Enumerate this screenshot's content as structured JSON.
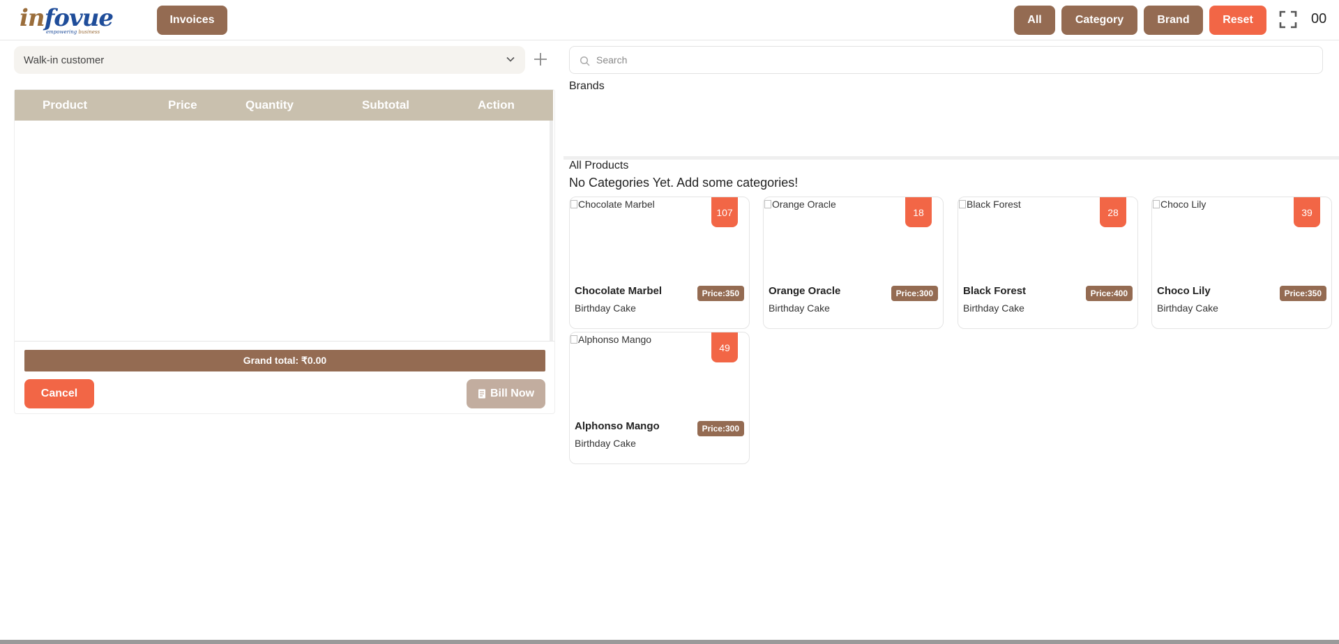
{
  "header": {
    "logo": {
      "word_part1": "in",
      "word_part2": "fovue",
      "tagline_part1": "empowering",
      "tagline_part2": "business"
    },
    "invoices_label": "Invoices",
    "filters": {
      "all": "All",
      "category": "Category",
      "brand": "Brand",
      "reset": "Reset"
    },
    "clock": "00"
  },
  "cart": {
    "customer": "Walk-in customer",
    "columns": [
      "Product",
      "Price",
      "Quantity",
      "Subtotal",
      "Action"
    ],
    "grand_total": "Grand total: ₹0.00",
    "cancel_label": "Cancel",
    "bill_label": "Bill Now"
  },
  "catalog": {
    "search_placeholder": "Search",
    "brands_title": "Brands",
    "all_products_title": "All Products",
    "no_categories": "No Categories Yet. Add some categories!",
    "products": [
      {
        "name": "Chocolate Marbel",
        "category": "Birthday Cake",
        "price": "Price:350",
        "stock": "107"
      },
      {
        "name": "Orange Oracle",
        "category": "Birthday Cake",
        "price": "Price:300",
        "stock": "18"
      },
      {
        "name": "Black Forest",
        "category": "Birthday Cake",
        "price": "Price:400",
        "stock": "28"
      },
      {
        "name": "Choco Lily",
        "category": "Birthday Cake",
        "price": "Price:350",
        "stock": "39"
      },
      {
        "name": "Alphonso Mango",
        "category": "Birthday Cake",
        "price": "Price:300",
        "stock": "49"
      }
    ]
  },
  "colors": {
    "brand_brown": "#946b52",
    "accent_orange": "#f26646",
    "table_header": "#c9c0ae",
    "bill_button": "#c2ad9f"
  },
  "icons": {
    "fullscreen": "fullscreen-icon",
    "add": "plus-icon",
    "dropdown": "chevron-down-icon",
    "search": "search-icon",
    "bill": "receipt-icon"
  }
}
